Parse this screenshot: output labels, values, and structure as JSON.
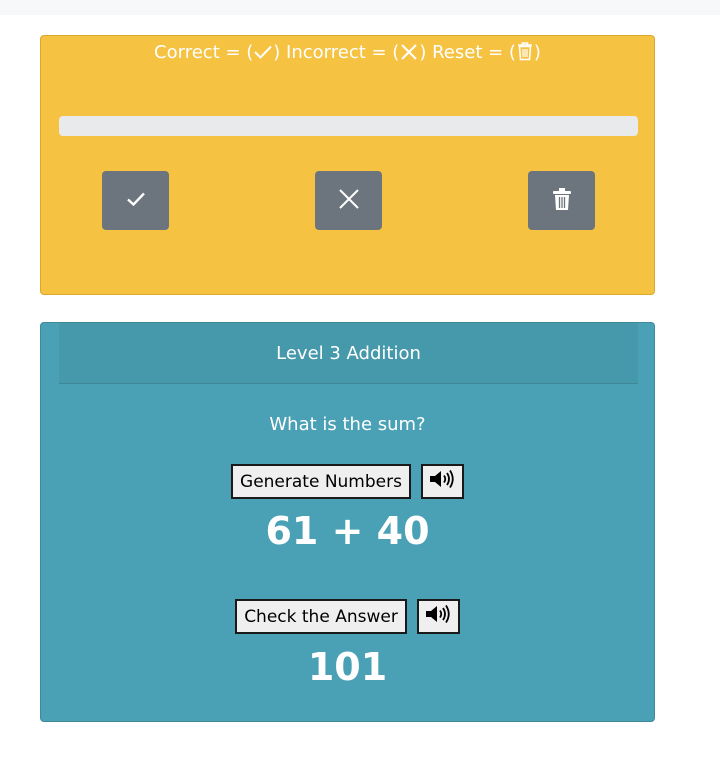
{
  "legend": {
    "correct_label": "Correct = (",
    "incorrect_label": ") Incorrect = (",
    "reset_label": ") Reset = (",
    "close_paren": ")"
  },
  "progress": {
    "value_fraction": 0
  },
  "controls": [
    {
      "icon": "checkmark-icon"
    },
    {
      "icon": "x-icon"
    },
    {
      "icon": "trash-icon"
    }
  ],
  "quiz": {
    "title": "Level 3 Addition",
    "question": "What is the sum?",
    "generate_label": "Generate Numbers",
    "problem": "61 + 40",
    "check_label": "Check the Answer",
    "answer": "101",
    "speaker_icon": "speaker-icon"
  },
  "colors": {
    "score_card": "#f5c242",
    "quiz_card": "#4aa0b4",
    "control_button": "#6c757d",
    "progress_track": "#e9eaec"
  }
}
